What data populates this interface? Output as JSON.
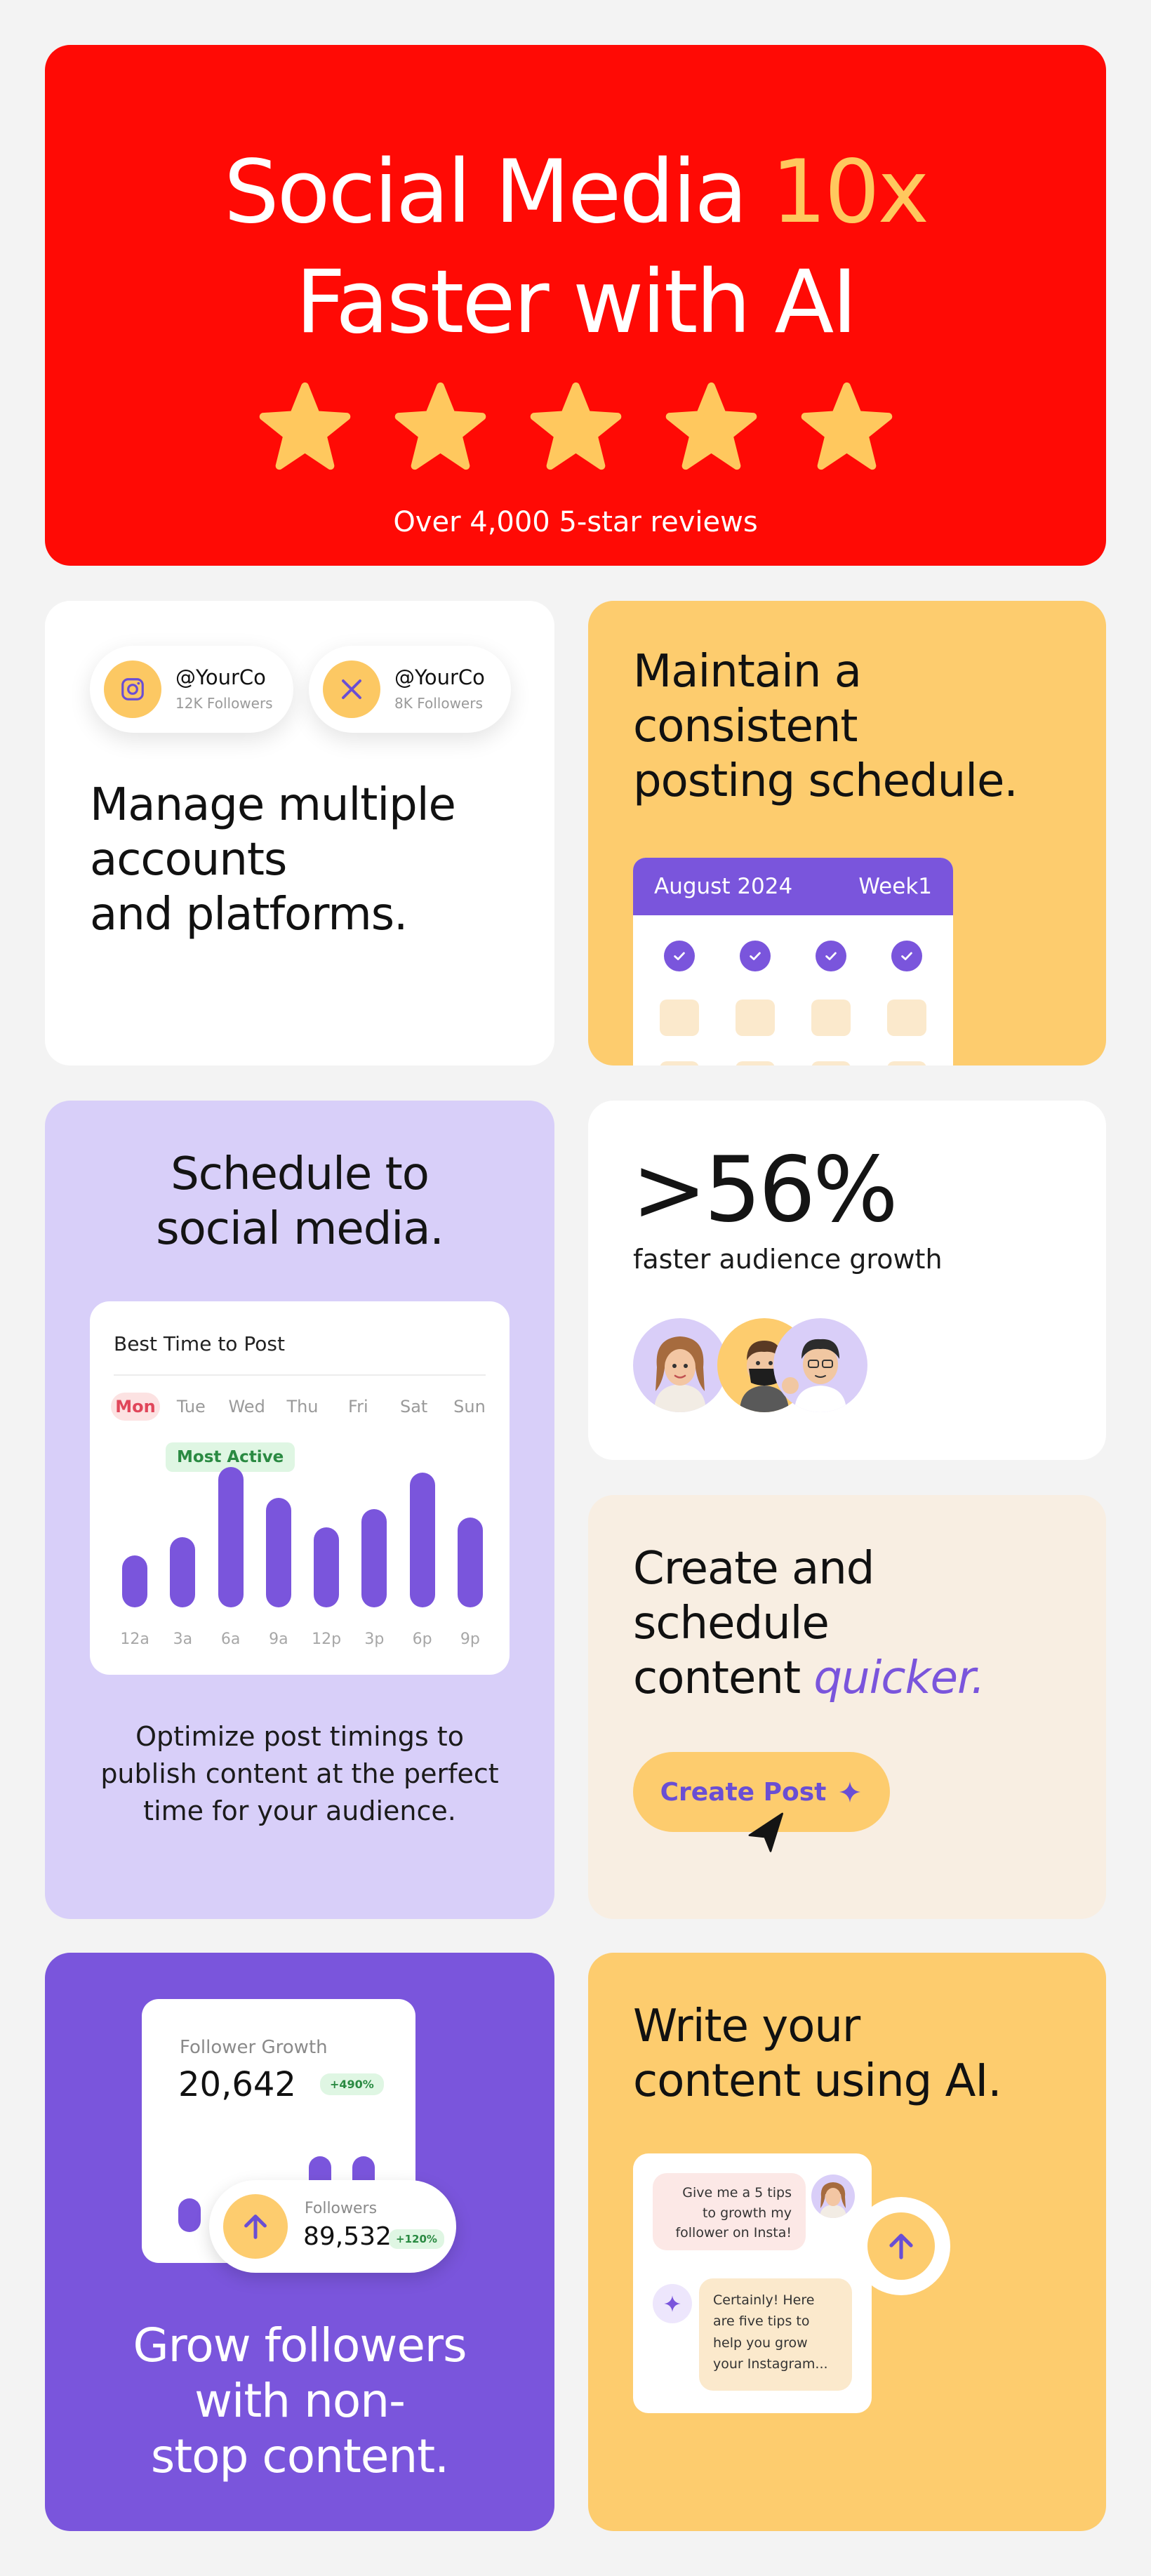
{
  "hero": {
    "title_pre": "Social Media ",
    "title_highlight": "10x",
    "title_line2": "Faster with AI",
    "rating_stars": 5,
    "reviews": "Over 4,000 5-star reviews"
  },
  "accounts": {
    "handles": [
      {
        "platform_icon": "instagram-icon",
        "name": "@YourCo",
        "followers": "12K Followers"
      },
      {
        "platform_icon": "x-icon",
        "name": "@YourCo",
        "followers": "8K Followers"
      }
    ],
    "heading": [
      "Manage multiple",
      "accounts",
      "and platforms."
    ]
  },
  "consistent": {
    "heading": [
      "Maintain a",
      "consistent",
      "posting schedule."
    ],
    "calendar": {
      "month": "August 2024",
      "week": "Week1"
    }
  },
  "schedule": {
    "title": [
      "Schedule to",
      "social media."
    ],
    "card_title": "Best Time to Post",
    "days": [
      "Mon",
      "Tue",
      "Wed",
      "Thu",
      "Fri",
      "Sat",
      "Sun"
    ],
    "active_day": "Mon",
    "badge": "Most Active",
    "times": [
      "12a",
      "3a",
      "6a",
      "9a",
      "12p",
      "3p",
      "6p",
      "9p"
    ],
    "activity": [
      0.37,
      0.5,
      1.0,
      0.78,
      0.57,
      0.7,
      0.96,
      0.64
    ],
    "description": [
      "Optimize post timings to",
      "publish content at the perfect",
      "time for your audience."
    ]
  },
  "stat": {
    "value": ">56%",
    "label": "faster audience growth"
  },
  "create": {
    "heading_lines": [
      "Create and",
      "schedule"
    ],
    "heading_last_pre": "content ",
    "heading_last_highlight": "quicker.",
    "button": "Create Post"
  },
  "grow": {
    "growth_label": "Follower Growth",
    "growth_value": "20,642",
    "growth_pct": "+490%",
    "followers_label": "Followers",
    "followers_value": "89,532",
    "followers_pct": "+120%",
    "growth_bars": [
      0.32,
      0.4,
      0.45,
      0.72,
      0.72
    ],
    "title": [
      "Grow followers",
      "with non-",
      "stop content."
    ]
  },
  "write": {
    "heading": [
      "Write your",
      "content using AI."
    ],
    "user_message": "Give me a 5 tips to growth my follower on Insta!",
    "ai_message": "Certainly! Here are five tips to help you grow your Instagram..."
  },
  "colors": {
    "red": "#ff0a05",
    "yellow": "#fdcc6e",
    "purple": "#7a55dc",
    "lavender": "#d8cff9",
    "cream": "#f8eee2"
  }
}
